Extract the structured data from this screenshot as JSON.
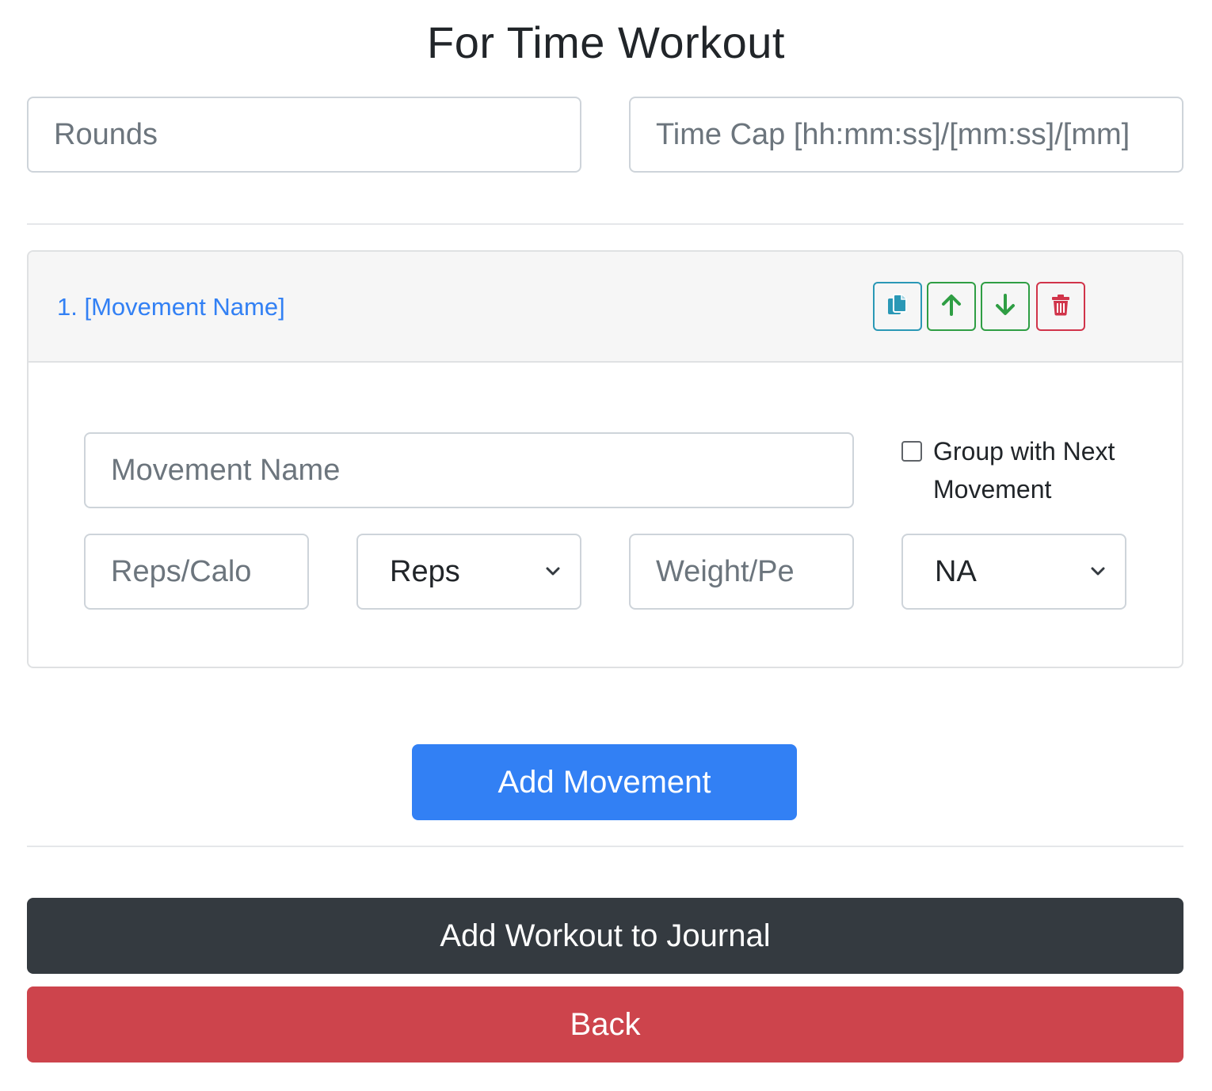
{
  "page": {
    "title": "For Time Workout"
  },
  "inputs": {
    "rounds_placeholder": "Rounds",
    "time_cap_placeholder": "Time Cap [hh:mm:ss]/[mm:ss]/[mm]"
  },
  "movement_card": {
    "title": "1. [Movement Name]",
    "actions": {
      "copy_icon": "copy-icon",
      "up_icon": "arrow-up-icon",
      "down_icon": "arrow-down-icon",
      "delete_icon": "trash-icon"
    },
    "movement_name_placeholder": "Movement Name",
    "group_checkbox_label": "Group with Next Movement",
    "group_checked": false,
    "reps_placeholder": "Reps/Calo",
    "reps_unit_selected": "Reps",
    "weight_placeholder": "Weight/Pe",
    "weight_unit_selected": "NA"
  },
  "buttons": {
    "add_movement": "Add Movement",
    "add_workout": "Add Workout to Journal",
    "back": "Back"
  },
  "colors": {
    "primary": "#3280f4",
    "dark": "#343a40",
    "danger": "#cd444c",
    "info": "#2a98b6",
    "success": "#2f9e44"
  }
}
